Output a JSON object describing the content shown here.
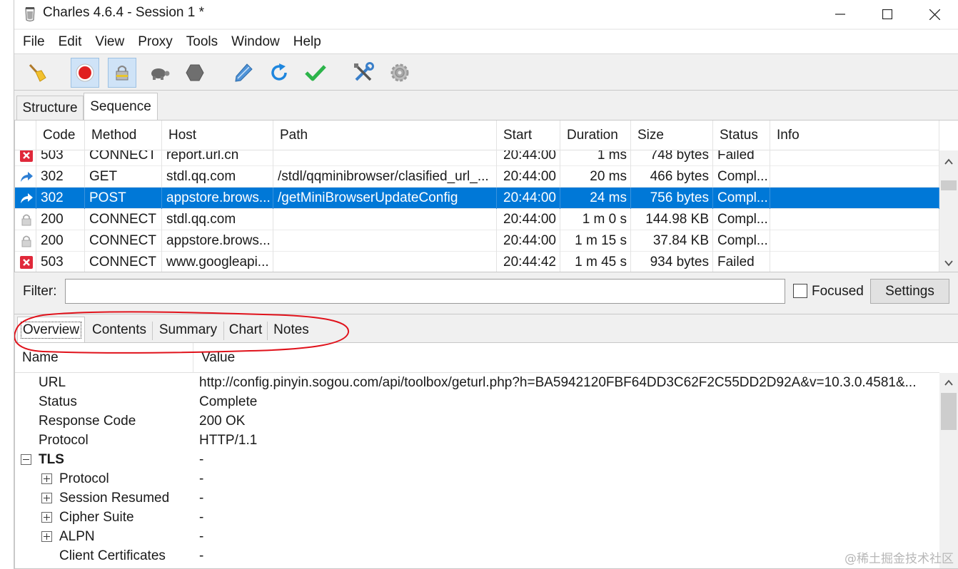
{
  "window": {
    "title": "Charles 4.6.4 - Session 1 *"
  },
  "menu": [
    "File",
    "Edit",
    "View",
    "Proxy",
    "Tools",
    "Window",
    "Help"
  ],
  "toolbar": {
    "buttons": [
      {
        "icon": "broom-icon",
        "pressed": false
      },
      {
        "icon": "record-icon",
        "pressed": true
      },
      {
        "icon": "ssl-lock-icon",
        "pressed": true
      },
      {
        "icon": "throttle-turtle-icon",
        "pressed": false
      },
      {
        "icon": "breakpoint-hexagon-icon",
        "pressed": false
      },
      {
        "icon": "compose-pen-icon",
        "pressed": false
      },
      {
        "icon": "repeat-icon",
        "pressed": false
      },
      {
        "icon": "validate-check-icon",
        "pressed": false
      },
      {
        "icon": "tools-icon",
        "pressed": false
      },
      {
        "icon": "settings-gear-icon",
        "pressed": false
      }
    ]
  },
  "view_tabs": {
    "structure": "Structure",
    "sequence": "Sequence",
    "active": "Sequence"
  },
  "table": {
    "columns": [
      "Code",
      "Method",
      "Host",
      "Path",
      "Start",
      "Duration",
      "Size",
      "Status",
      "Info"
    ],
    "rows": [
      {
        "icon": "failed-icon",
        "code": "503",
        "method": "CONNECT",
        "host": "report.url.cn",
        "path": "",
        "start": "20:44:00",
        "duration": "1 ms",
        "size": "748 bytes",
        "status": "Failed",
        "info": ""
      },
      {
        "icon": "redirect-icon",
        "code": "302",
        "method": "GET",
        "host": "stdl.qq.com",
        "path": "/stdl/qqminibrowser/clasified_url_...",
        "start": "20:44:00",
        "duration": "20 ms",
        "size": "466 bytes",
        "status": "Compl...",
        "info": ""
      },
      {
        "icon": "redirect-icon",
        "code": "302",
        "method": "POST",
        "host": "appstore.brows...",
        "path": "/getMiniBrowserUpdateConfig",
        "start": "20:44:00",
        "duration": "24 ms",
        "size": "756 bytes",
        "status": "Compl...",
        "info": "",
        "selected": true
      },
      {
        "icon": "lock-icon",
        "code": "200",
        "method": "CONNECT",
        "host": "stdl.qq.com",
        "path": "",
        "start": "20:44:00",
        "duration": "1 m 0 s",
        "size": "144.98 KB",
        "status": "Compl...",
        "info": ""
      },
      {
        "icon": "lock-icon",
        "code": "200",
        "method": "CONNECT",
        "host": "appstore.brows...",
        "path": "",
        "start": "20:44:00",
        "duration": "1 m 15 s",
        "size": "37.84 KB",
        "status": "Compl...",
        "info": ""
      },
      {
        "icon": "failed-icon",
        "code": "503",
        "method": "CONNECT",
        "host": "www.googleapi...",
        "path": "",
        "start": "20:44:42",
        "duration": "1 m 45 s",
        "size": "934 bytes",
        "status": "Failed",
        "info": ""
      }
    ]
  },
  "filter": {
    "label": "Filter:",
    "value": "",
    "focused_label": "Focused",
    "focused_checked": false,
    "settings_label": "Settings"
  },
  "detail_tabs": {
    "items": [
      "Overview",
      "Contents",
      "Summary",
      "Chart",
      "Notes"
    ],
    "active": "Overview"
  },
  "overview": {
    "columns": [
      "Name",
      "Value"
    ],
    "rows": [
      {
        "name": "URL",
        "value": "http://config.pinyin.sogou.com/api/toolbox/geturl.php?h=BA5942120FBF64DD3C62F2C55DD2D92A&v=10.3.0.4581&..."
      },
      {
        "name": "Status",
        "value": "Complete"
      },
      {
        "name": "Response Code",
        "value": "200 OK"
      },
      {
        "name": "Protocol",
        "value": "HTTP/1.1"
      },
      {
        "name": "TLS",
        "value": "-",
        "bold": true,
        "expanded": true
      },
      {
        "name": "Protocol",
        "value": "-",
        "child": true,
        "toggle": "plus"
      },
      {
        "name": "Session Resumed",
        "value": "-",
        "child": true,
        "toggle": "plus"
      },
      {
        "name": "Cipher Suite",
        "value": "-",
        "child": true,
        "toggle": "plus"
      },
      {
        "name": "ALPN",
        "value": "-",
        "child": true,
        "toggle": "plus"
      },
      {
        "name": "Client Certificates",
        "value": "-",
        "child": true
      }
    ]
  },
  "watermark": "@稀土掘金技术社区",
  "colors": {
    "selection": "#0078d7",
    "annotation": "#e0121b",
    "failed": "#e0283a",
    "redirect": "#2e7fd4"
  }
}
